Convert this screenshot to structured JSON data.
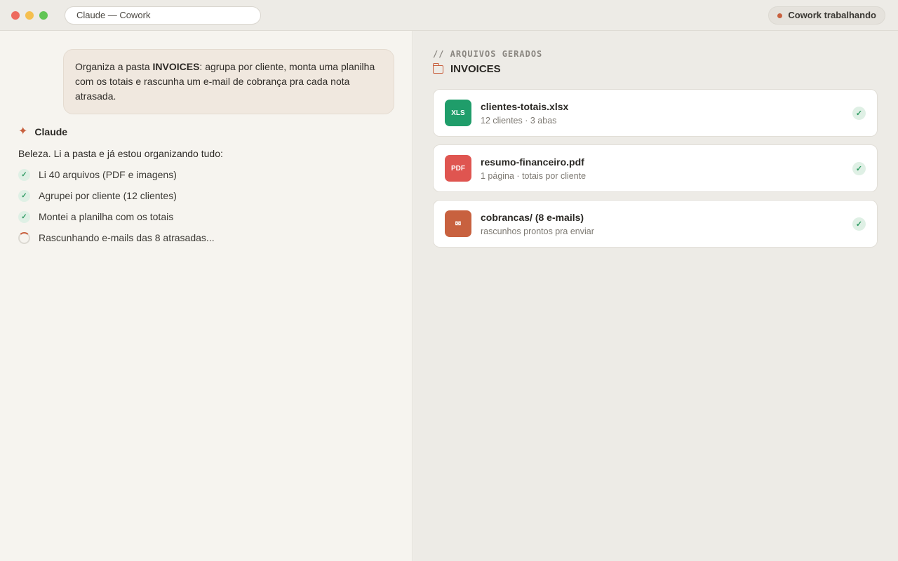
{
  "window": {
    "title": "Claude — Cowork",
    "status": "Cowork trabalhando",
    "status_color": "#c8613f"
  },
  "chat": {
    "user_message": {
      "before": "Organiza a pasta ",
      "bold": "INVOICES",
      "after": ": agrupa por cliente, monta uma planilha com os totais e rascunha um e-mail de cobrança pra cada nota atrasada."
    },
    "assistant_name": "Claude",
    "assistant_icon": "sparkle-icon",
    "intro": "Beleza. Li a pasta e já estou organizando tudo:",
    "steps": [
      {
        "label": "Li 40 arquivos (PDF e imagens)",
        "state": "done",
        "icon": "check-icon"
      },
      {
        "label": "Agrupei por cliente (12 clientes)",
        "state": "done",
        "icon": "check-icon"
      },
      {
        "label": "Montei a planilha com os totais",
        "state": "done",
        "icon": "check-icon"
      },
      {
        "label": "Rascunhando e-mails das 8 atrasadas...",
        "state": "in_progress",
        "icon": "spinner-icon"
      }
    ]
  },
  "output": {
    "section_label": "// ARQUIVOS GERADOS",
    "folder_icon": "folder-icon",
    "folder": "INVOICES",
    "files": [
      {
        "badge": "XLS",
        "badge_color": "#1f9d6a",
        "name": "clientes-totais.xlsx",
        "meta": "12 clientes · 3 abas",
        "status_icon": "check-icon"
      },
      {
        "badge": "PDF",
        "badge_color": "#df5550",
        "name": "resumo-financeiro.pdf",
        "meta": "1 página · totais por cliente",
        "status_icon": "check-icon"
      },
      {
        "badge": "✉",
        "badge_color": "#c8613f",
        "name": "cobrancas/ (8 e-mails)",
        "meta": "rascunhos prontos pra enviar",
        "status_icon": "check-icon"
      }
    ]
  }
}
